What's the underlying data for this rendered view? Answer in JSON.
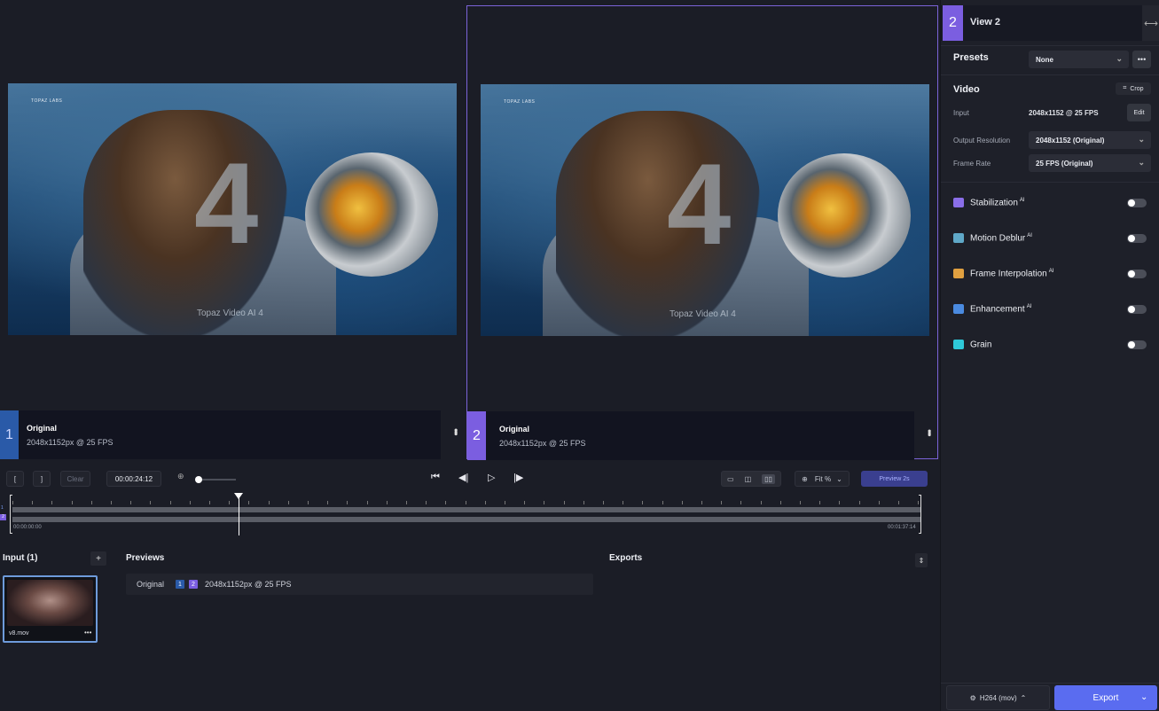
{
  "viewers": [
    {
      "badge": "1",
      "title": "Original",
      "subtitle": "2048x1152px @ 25 FPS",
      "brand": "TOPAZ LABS",
      "big_number": "4",
      "watermark": "Topaz Video AI 4"
    },
    {
      "badge": "2",
      "title": "Original",
      "subtitle": "2048x1152px @ 25 FPS",
      "brand": "TOPAZ LABS",
      "big_number": "4",
      "watermark": "Topaz Video AI 4"
    }
  ],
  "panel": {
    "view_badge": "2",
    "view_title": "View 2",
    "presets_label": "Presets",
    "presets_value": "None",
    "video_title": "Video",
    "crop_label": "Crop",
    "input_label": "Input",
    "input_value": "2048x1152 @ 25 FPS",
    "edit_label": "Edit",
    "output_resolution_label": "Output Resolution",
    "output_resolution_value": "2048x1152 (Original)",
    "frame_rate_label": "Frame Rate",
    "frame_rate_value": "25 FPS (Original)",
    "toggles": [
      {
        "label": "Stabilization",
        "ai": "AI",
        "color": "#8a6ee8"
      },
      {
        "label": "Motion Deblur",
        "ai": "AI",
        "color": "#5fa8c8"
      },
      {
        "label": "Frame Interpolation",
        "ai": "AI",
        "color": "#e0a040"
      },
      {
        "label": "Enhancement",
        "ai": "AI",
        "color": "#4a8ae0"
      },
      {
        "label": "Grain",
        "ai": "",
        "color": "#2ec8d8"
      }
    ],
    "format_label": "H264 (mov)",
    "export_label": "Export"
  },
  "transport": {
    "in_mark": "[",
    "out_mark": "]",
    "clear_label": "Clear",
    "timecode": "00:00:24:12",
    "fit_label": "Fit %",
    "preview_label": "Preview 2s"
  },
  "timeline": {
    "start_time": "00:00:00:00",
    "end_time": "00:01:37:14",
    "track1_label": "1",
    "track2_label": "2"
  },
  "input_pane": {
    "title": "Input (1)",
    "add_label": "+",
    "file_name": "v8.mov",
    "more": "•••"
  },
  "previews_pane": {
    "title": "Previews",
    "row_name": "Original",
    "badge1": "1",
    "badge2": "2",
    "row_res": "2048x1152px @ 25 FPS"
  },
  "exports_pane": {
    "title": "Exports"
  }
}
